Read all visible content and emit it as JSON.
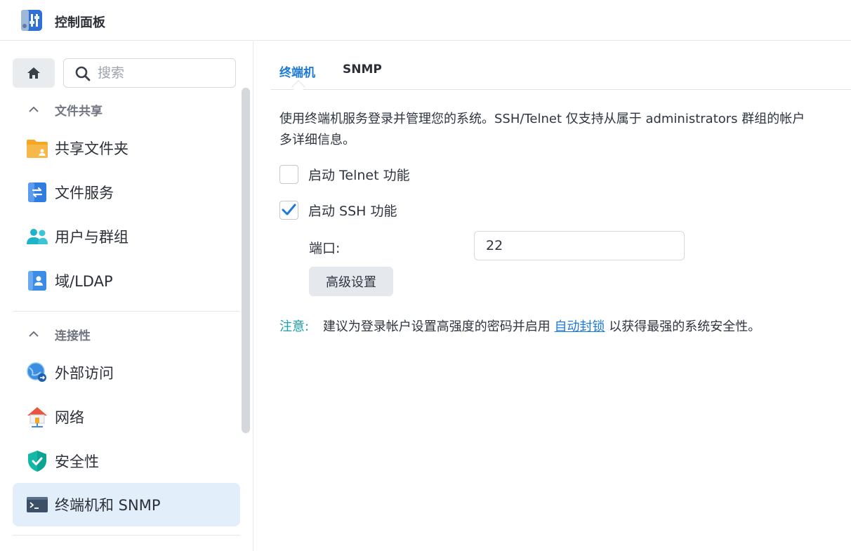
{
  "app": {
    "title": "控制面板"
  },
  "sidebar": {
    "search": {
      "placeholder": "搜索",
      "value": ""
    },
    "groups": [
      {
        "title": "文件共享",
        "items": [
          {
            "label": "共享文件夹",
            "icon": "folder-share-icon"
          },
          {
            "label": "文件服务",
            "icon": "file-services-icon"
          },
          {
            "label": "用户与群组",
            "icon": "users-groups-icon"
          },
          {
            "label": "域/LDAP",
            "icon": "domain-ldap-icon"
          }
        ]
      },
      {
        "title": "连接性",
        "items": [
          {
            "label": "外部访问",
            "icon": "external-access-icon"
          },
          {
            "label": "网络",
            "icon": "network-icon"
          },
          {
            "label": "安全性",
            "icon": "security-shield-icon"
          },
          {
            "label": "终端机和 SNMP",
            "icon": "terminal-icon",
            "active": true
          }
        ]
      }
    ]
  },
  "main": {
    "tabs": [
      {
        "label": "终端机",
        "active": true
      },
      {
        "label": "SNMP",
        "active": false
      }
    ],
    "description_line1": "使用终端机服务登录并管理您的系统。SSH/Telnet 仅支持从属于 administrators 群组的帐户",
    "description_line2": "多详细信息。",
    "telnet": {
      "label": "启动 Telnet 功能",
      "checked": false
    },
    "ssh": {
      "label": "启动 SSH 功能",
      "checked": true
    },
    "port": {
      "label": "端口:",
      "value": "22"
    },
    "advanced_button": "高级设置",
    "note": {
      "label": "注意:",
      "text_before": "建议为登录帐户设置高强度的密码并启用",
      "link": "自动封锁",
      "text_after": "以获得最强的系统安全性。"
    }
  },
  "colors": {
    "accent": "#1d7ad9",
    "note": "#1a9fb0",
    "active_bg": "#e3eefb"
  }
}
